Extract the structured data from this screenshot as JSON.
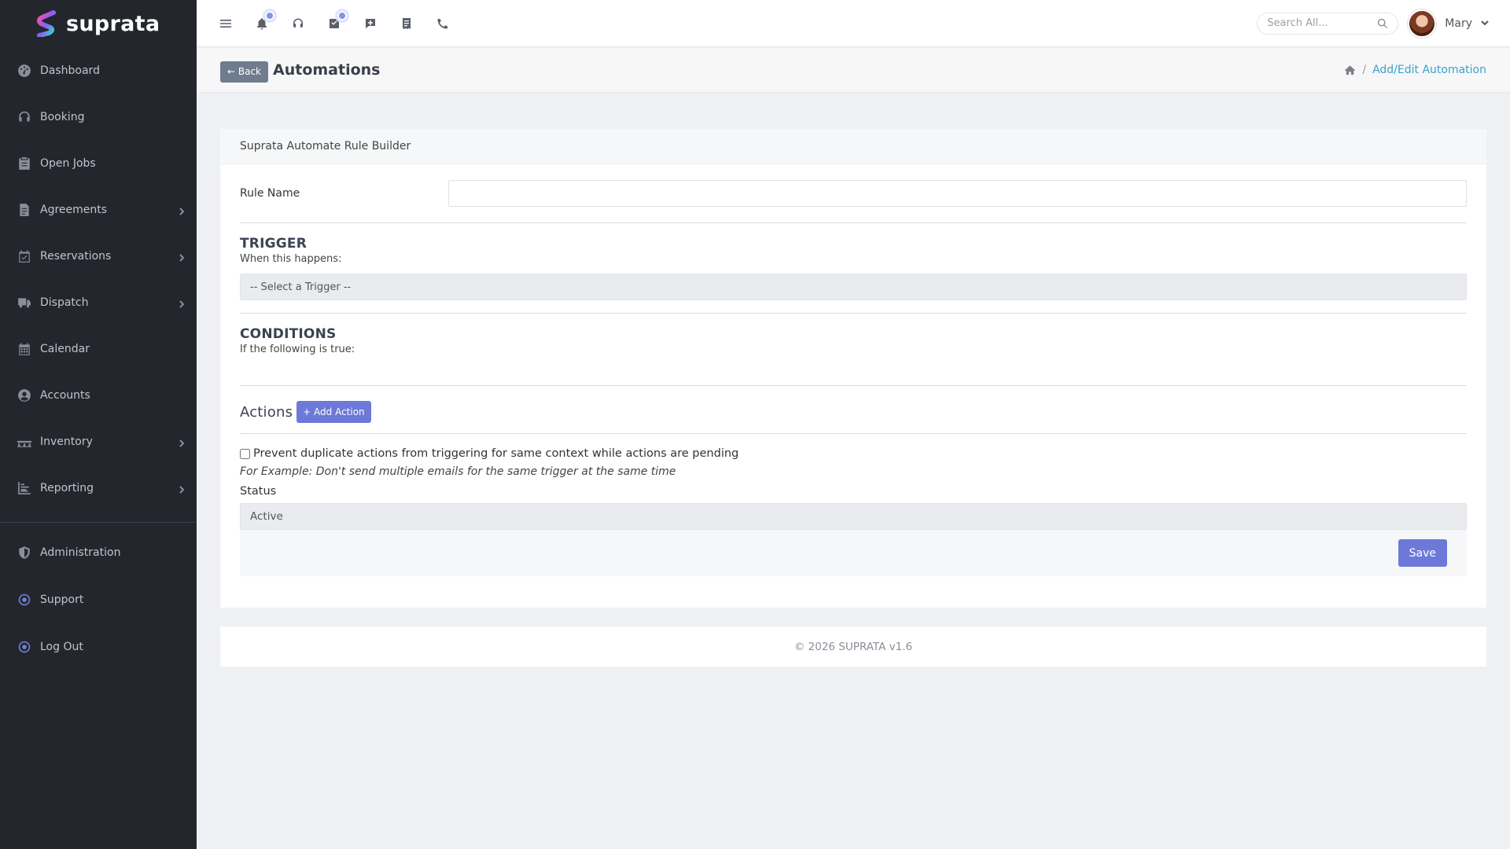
{
  "brand": {
    "name": "suprata"
  },
  "sidebar": {
    "items": [
      {
        "label": "Dashboard",
        "icon": "dashboard-icon",
        "has_submenu": false
      },
      {
        "label": "Booking",
        "icon": "headset-icon",
        "has_submenu": false
      },
      {
        "label": "Open Jobs",
        "icon": "clipboard-icon",
        "has_submenu": false
      },
      {
        "label": "Agreements",
        "icon": "document-icon",
        "has_submenu": true
      },
      {
        "label": "Reservations",
        "icon": "calendar-check-icon",
        "has_submenu": true
      },
      {
        "label": "Dispatch",
        "icon": "truck-icon",
        "has_submenu": true
      },
      {
        "label": "Calendar",
        "icon": "calendar-icon",
        "has_submenu": false
      },
      {
        "label": "Accounts",
        "icon": "user-circle-icon",
        "has_submenu": false
      },
      {
        "label": "Inventory",
        "icon": "pallet-icon",
        "has_submenu": true
      },
      {
        "label": "Reporting",
        "icon": "chart-bar-icon",
        "has_submenu": true
      }
    ],
    "bottom_items": [
      {
        "label": "Administration",
        "icon": "shield-icon"
      },
      {
        "label": "Support",
        "icon": "dot-circle-icon"
      },
      {
        "label": "Log Out",
        "icon": "dot-circle-icon"
      }
    ]
  },
  "topbar": {
    "icons": [
      "menu-icon",
      "bell-icon",
      "headset-icon",
      "tasks-icon",
      "chat-plus-icon",
      "receipt-icon",
      "phone-icon"
    ],
    "search_placeholder": "Search All...",
    "user_name": "Mary"
  },
  "header": {
    "back_label": "← Back",
    "title": "Automations",
    "breadcrumb_current": "Add/Edit Automation"
  },
  "form": {
    "card_title": "Suprata Automate Rule Builder",
    "rule_name_label": "Rule Name",
    "rule_name_value": "",
    "trigger_title": "TRIGGER",
    "trigger_sub": "When this happens:",
    "trigger_select": "-- Select a Trigger --",
    "conditions_title": "CONDITIONS",
    "conditions_sub": "If the following is true:",
    "actions_title": "Actions",
    "add_action_label": "+ Add Action",
    "dup_label": "Prevent duplicate actions from triggering for same context while actions are pending",
    "dup_checked": false,
    "example": "For Example: Don't send multiple emails for the same trigger at the same time",
    "status_label": "Status",
    "status_value": "Active",
    "save_label": "Save"
  },
  "footer": {
    "text": "© 2026 SUPRATA v1.6"
  },
  "colors": {
    "sidebar_bg": "#24262d",
    "accent": "#6c79d8",
    "link": "#3aa2cf",
    "back_button": "#6e7c8d"
  }
}
